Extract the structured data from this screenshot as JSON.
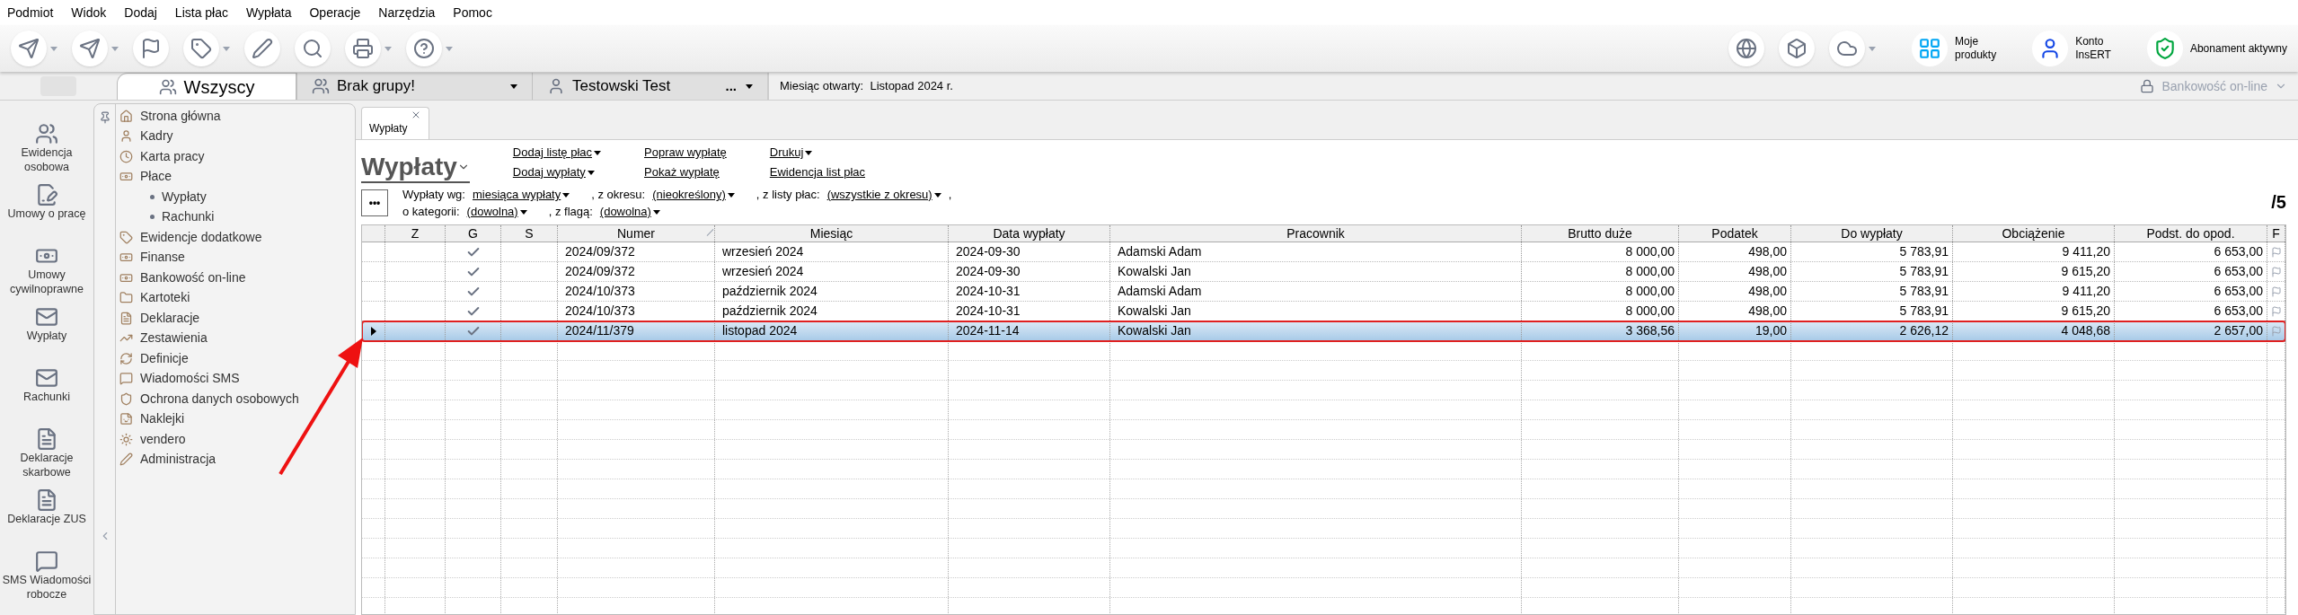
{
  "menu": [
    "Podmiot",
    "Widok",
    "Dodaj",
    "Lista płac",
    "Wypłata",
    "Operacje",
    "Narzędzia",
    "Pomoc"
  ],
  "toolbar": {
    "right_items": [
      {
        "lines": [
          "Moje",
          "produkty"
        ],
        "kind": "products"
      },
      {
        "lines": [
          "Konto",
          "InsERT"
        ],
        "kind": "account"
      },
      {
        "lines": [
          "Abonament aktywny"
        ],
        "kind": "shield"
      }
    ]
  },
  "tabs": [
    {
      "label": "Wszyscy",
      "selected": true,
      "kind": "plain"
    },
    {
      "label": "Brak grupy!",
      "selected": false,
      "kind": "dropdown"
    },
    {
      "label": "Testowski Test",
      "selected": false,
      "kind": "more",
      "more": "..."
    }
  ],
  "status": "Miesiąc otwarty:  Listopad 2024 r.",
  "bank": "Bankowość on-line",
  "modules": [
    "Ewidencja osobowa",
    "Umowy o pracę",
    "Umowy cywilnoprawne",
    "Wypłaty",
    "Rachunki",
    "Deklaracje skarbowe",
    "Deklaracje ZUS",
    "SMS Wiadomości robocze"
  ],
  "nav_tree": [
    {
      "label": "Strona główna"
    },
    {
      "label": "Kadry"
    },
    {
      "label": "Karta pracy"
    },
    {
      "label": "Płace",
      "children": [
        {
          "label": "Wypłaty"
        },
        {
          "label": "Rachunki"
        }
      ]
    },
    {
      "label": "Ewidencje dodatkowe"
    },
    {
      "label": "Finanse"
    },
    {
      "label": "Bankowość on-line"
    },
    {
      "label": "Kartoteki"
    },
    {
      "label": "Deklaracje"
    },
    {
      "label": "Zestawienia"
    },
    {
      "label": "Definicje"
    },
    {
      "label": "Wiadomości SMS"
    },
    {
      "label": "Ochrona danych osobowych"
    },
    {
      "label": "Naklejki"
    },
    {
      "label": "vendero"
    },
    {
      "label": "Administracja"
    }
  ],
  "doc_tab": {
    "label": "Wypłaty"
  },
  "page_title": "Wypłaty",
  "actions": [
    [
      {
        "label": "Dodaj listę płac",
        "dropdown": true
      },
      {
        "label": "Dodaj wypłaty",
        "dropdown": true
      }
    ],
    [
      {
        "label": "Popraw wypłatę",
        "dropdown": false
      },
      {
        "label": "Pokaż wypłatę",
        "dropdown": false
      }
    ],
    [
      {
        "label": "Drukuj",
        "dropdown": true
      },
      {
        "label": "Ewidencja list płac",
        "dropdown": false
      }
    ]
  ],
  "more_button": "•••",
  "filters": [
    [
      {
        "label": "Wypłaty wg:",
        "value": "miesiąca wypłaty"
      },
      {
        "label": ", z okresu:",
        "value": "(nieokreślony)"
      },
      {
        "label": ", z listy płac:",
        "value": "(wszystkie z okresu)",
        "after": ","
      }
    ],
    [
      {
        "label": "o kategorii:",
        "value": "(dowolna)"
      },
      {
        "label": ", z flagą:",
        "value": "(dowolna)"
      }
    ]
  ],
  "count": "/5",
  "table": {
    "columns": [
      {
        "label": "Z",
        "kind": "empty",
        "sorted": false
      },
      {
        "label": "G",
        "kind": "check",
        "sorted": false
      },
      {
        "label": "S",
        "kind": "empty",
        "sorted": false
      },
      {
        "label": "Numer",
        "kind": "text",
        "sorted": true
      },
      {
        "label": "Miesiąc",
        "kind": "text",
        "sorted": false
      },
      {
        "label": "Data wypłaty",
        "kind": "text",
        "sorted": false
      },
      {
        "label": "Pracownik",
        "kind": "text",
        "sorted": false
      },
      {
        "label": "Brutto duże",
        "kind": "number",
        "sorted": false
      },
      {
        "label": "Podatek",
        "kind": "number",
        "sorted": false
      },
      {
        "label": "Do wypłaty",
        "kind": "number",
        "sorted": false
      },
      {
        "label": "Obciążenie",
        "kind": "number",
        "sorted": false
      },
      {
        "label": "Podst. do opod.",
        "kind": "number",
        "sorted": false
      },
      {
        "label": "F",
        "kind": "flag",
        "sorted": false
      }
    ],
    "rows": [
      {
        "selected": false,
        "highlighted": false,
        "g": true,
        "cells": [
          "2024/09/372",
          "wrzesień 2024",
          "2024-09-30",
          "Adamski Adam",
          "8 000,00",
          "498,00",
          "5 783,91",
          "9 411,20",
          "6 653,00"
        ]
      },
      {
        "selected": false,
        "highlighted": false,
        "g": true,
        "cells": [
          "2024/09/372",
          "wrzesień 2024",
          "2024-09-30",
          "Kowalski Jan",
          "8 000,00",
          "498,00",
          "5 783,91",
          "9 615,20",
          "6 653,00"
        ]
      },
      {
        "selected": false,
        "highlighted": false,
        "g": true,
        "cells": [
          "2024/10/373",
          "październik 2024",
          "2024-10-31",
          "Adamski Adam",
          "8 000,00",
          "498,00",
          "5 783,91",
          "9 411,20",
          "6 653,00"
        ]
      },
      {
        "selected": false,
        "highlighted": false,
        "g": true,
        "cells": [
          "2024/10/373",
          "październik 2024",
          "2024-10-31",
          "Kowalski Jan",
          "8 000,00",
          "498,00",
          "5 783,91",
          "9 615,20",
          "6 653,00"
        ]
      },
      {
        "selected": true,
        "highlighted": true,
        "g": true,
        "cells": [
          "2024/11/379",
          "listopad 2024",
          "2024-11-14",
          "Kowalski Jan",
          "3 368,56",
          "19,00",
          "2 626,12",
          "4 048,68",
          "2 657,00"
        ]
      }
    ]
  }
}
